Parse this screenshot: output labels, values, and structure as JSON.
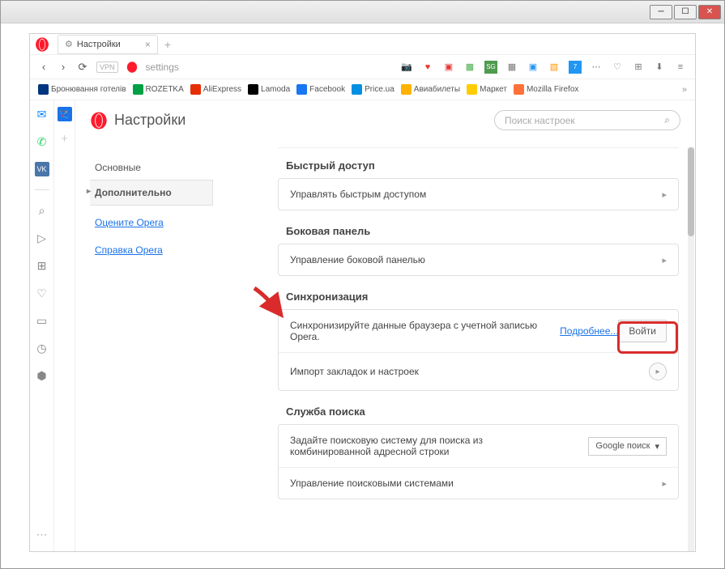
{
  "tab": {
    "title": "Настройки"
  },
  "address": {
    "vpn": "VPN",
    "text": "settings"
  },
  "bookmarks": [
    {
      "label": "Бронювання готелів",
      "color": "#003580"
    },
    {
      "label": "ROZETKA",
      "color": "#00a046"
    },
    {
      "label": "AliExpress",
      "color": "#e62e04"
    },
    {
      "label": "Lamoda",
      "color": "#000"
    },
    {
      "label": "Facebook",
      "color": "#1877f2"
    },
    {
      "label": "Price.ua",
      "color": "#0090e3"
    },
    {
      "label": "Авиабилеты",
      "color": "#ffb300"
    },
    {
      "label": "Маркет",
      "color": "#ffcc00"
    },
    {
      "label": "Mozilla Firefox",
      "color": "#ff7139"
    }
  ],
  "page": {
    "title": "Настройки",
    "search_placeholder": "Поиск настроек"
  },
  "sidenav": {
    "basic": "Основные",
    "advanced": "Дополнительно",
    "rate": "Оцените Opera",
    "help": "Справка Opera"
  },
  "sections": {
    "speed": {
      "title": "Быстрый доступ",
      "row": "Управлять быстрым доступом"
    },
    "sidebar": {
      "title": "Боковая панель",
      "row": "Управление боковой панелью"
    },
    "sync": {
      "title": "Синхронизация",
      "text": "Синхронизируйте данные браузера с учетной записью Opera.",
      "more": "Подробнее...",
      "login": "Войти",
      "import": "Импорт закладок и настроек"
    },
    "search": {
      "title": "Служба поиска",
      "text": "Задайте поисковую систему для поиска из комбинированной адресной строки",
      "engine": "Google поиск",
      "manage": "Управление поисковыми системами"
    }
  }
}
